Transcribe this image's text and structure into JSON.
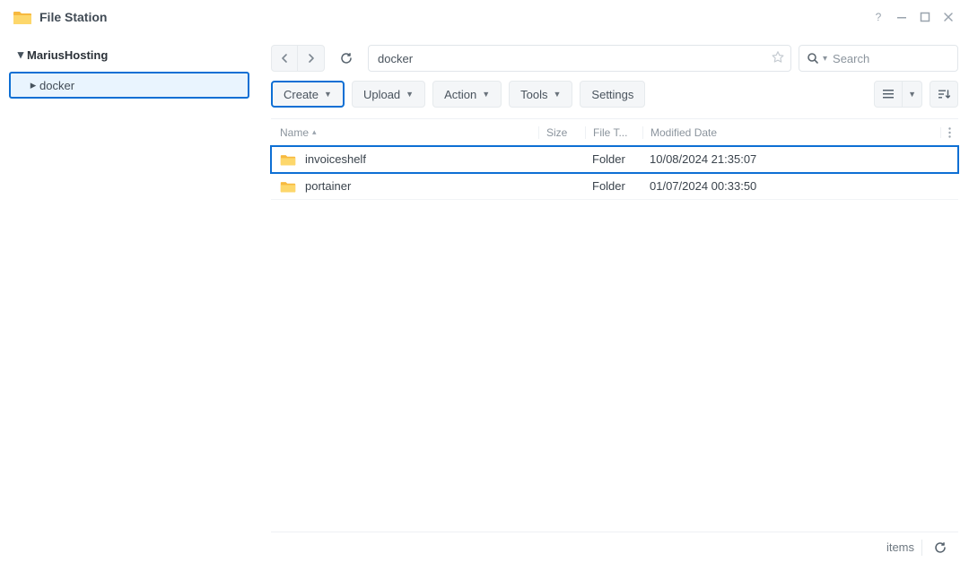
{
  "app": {
    "title": "File Station"
  },
  "sidebar": {
    "root": "MariusHosting",
    "child": "docker"
  },
  "toolbar": {
    "path": "docker",
    "search_placeholder": "Search",
    "buttons": {
      "create": "Create",
      "upload": "Upload",
      "action": "Action",
      "tools": "Tools",
      "settings": "Settings"
    }
  },
  "columns": {
    "name": "Name",
    "size": "Size",
    "type": "File T...",
    "date": "Modified Date"
  },
  "rows": [
    {
      "name": "invoiceshelf",
      "type": "Folder",
      "date": "10/08/2024 21:35:07",
      "highlight": true
    },
    {
      "name": "portainer",
      "type": "Folder",
      "date": "01/07/2024 00:33:50",
      "highlight": false
    }
  ],
  "status": {
    "items": "items"
  },
  "icons": {
    "folder_color": "#f7b93f"
  }
}
